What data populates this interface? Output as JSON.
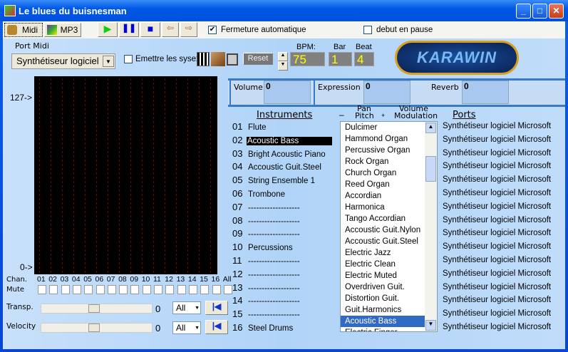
{
  "window": {
    "title": "Le blues du buisnesman"
  },
  "toolbar": {
    "tab_midi": "Midi",
    "tab_mp3": "MP3",
    "fermeture_label": "Fermeture automatique",
    "fermeture_checked": true,
    "pause_label": "debut en pause",
    "pause_checked": false
  },
  "midi": {
    "port_label": "Port Midi",
    "port_value": "Synthétiseur logiciel",
    "sysex_label": "Emettre les sysex",
    "reset_label": "Reset",
    "bpm_label": "BPM:",
    "bpm": "75",
    "bar_label": "Bar",
    "bar": "1",
    "beat_label": "Beat",
    "beat": "4",
    "logo": "KARAWIN"
  },
  "controls": {
    "volume_label": "Volume",
    "volume": "0",
    "expression_label": "Expression",
    "expression": "0",
    "reverb_label": "Reverb",
    "reverb": "0"
  },
  "meter": {
    "top_label": "127->",
    "bottom_label": "0->",
    "chan_label": "Chan.",
    "mute_label": "Mute",
    "channels": [
      "01",
      "02",
      "03",
      "04",
      "05",
      "06",
      "07",
      "08",
      "09",
      "10",
      "11",
      "12",
      "13",
      "14",
      "15",
      "16",
      "All"
    ]
  },
  "transp": {
    "label": "Transp.",
    "value": "0",
    "select": "All"
  },
  "velocity": {
    "label": "Velocity",
    "value": "0",
    "select": "All"
  },
  "headers": {
    "instruments": "Instruments",
    "minus": "–",
    "pan": "Pan",
    "pitch": "Pitch",
    "plus": "+",
    "volume": "Volume",
    "modulation": "Modulation",
    "ports": "Ports"
  },
  "instruments": [
    {
      "n": "01",
      "name": "Flute"
    },
    {
      "n": "02",
      "name": "Acoustic Bass",
      "selected": true
    },
    {
      "n": "03",
      "name": "Bright Acoustic Piano"
    },
    {
      "n": "04",
      "name": "Accoustic Guit.Steel"
    },
    {
      "n": "05",
      "name": "String Ensemble 1"
    },
    {
      "n": "06",
      "name": "Trombone"
    },
    {
      "n": "07",
      "name": "-------------------"
    },
    {
      "n": "08",
      "name": "-------------------"
    },
    {
      "n": "09",
      "name": "-------------------"
    },
    {
      "n": "10",
      "name": "Percussions"
    },
    {
      "n": "11",
      "name": "-------------------"
    },
    {
      "n": "12",
      "name": "-------------------"
    },
    {
      "n": "13",
      "name": "-------------------"
    },
    {
      "n": "14",
      "name": "-------------------"
    },
    {
      "n": "15",
      "name": "-------------------"
    },
    {
      "n": "16",
      "name": "Steel Drums"
    }
  ],
  "port_name": "Synthétiseur logiciel Microsoft",
  "program_list": [
    "Dulcimer",
    "Hammond Organ",
    "Percussive Organ",
    "Rock Organ",
    "Church Organ",
    "Reed Organ",
    "Accordian",
    "Harmonica",
    "Tango Accordian",
    "Accoustic Guit.Nylon",
    "Accoustic Guit.Steel",
    "Electric Jazz",
    "Electric Clean",
    "Electric Muted",
    "Overdriven Guit.",
    "Distortion Guit.",
    "Guit.Harmonics",
    "Acoustic Bass",
    "Electric Finger"
  ],
  "program_selected": "Acoustic Bass"
}
